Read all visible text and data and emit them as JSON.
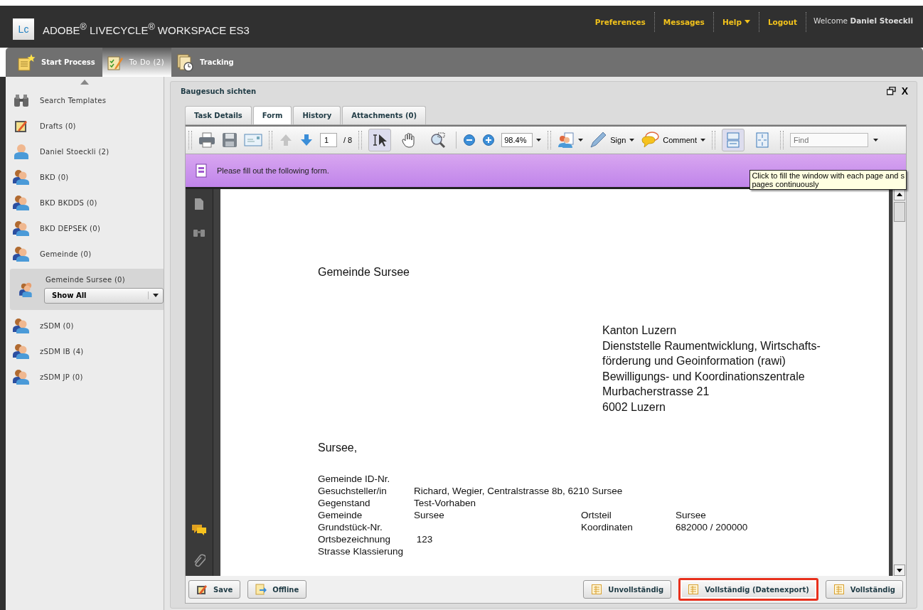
{
  "header": {
    "logo": "Lc",
    "title": "ADOBE$^{®}$ LIVECYCLE$^{®}$ WORKSPACE ES3",
    "links": [
      {
        "label": "Preferences",
        "dropdown": false
      },
      {
        "label": "Messages",
        "dropdown": false
      },
      {
        "label": "Help",
        "dropdown": true
      },
      {
        "label": "Logout",
        "dropdown": false
      }
    ],
    "welcome": "Welcome **Daniel Stoeckli**"
  },
  "app_tabs": [
    {
      "label": "Start Process",
      "kind": "start",
      "selected": false
    },
    {
      "label": "To Do (2)",
      "kind": "todo",
      "selected": true
    },
    {
      "label": "Tracking",
      "kind": "tracking",
      "selected": false
    }
  ],
  "sidebar": {
    "items": [
      {
        "label": "Search Templates",
        "kind": "search",
        "selected": false
      },
      {
        "label": "Drafts (0)",
        "kind": "drafts",
        "selected": false
      },
      {
        "label": "Daniel Stoeckli (2)",
        "kind": "person",
        "selected": false
      },
      {
        "label": "BKD (0)",
        "kind": "group",
        "selected": false
      },
      {
        "label": "BKD BKDDS (0)",
        "kind": "group",
        "selected": false
      },
      {
        "label": "BKD DEPSEK (0)",
        "kind": "group",
        "selected": false
      },
      {
        "label": "Gemeinde (0)",
        "kind": "group",
        "selected": false
      },
      {
        "label": "Gemeinde Sursee (0)",
        "kind": "group",
        "selected": true,
        "filter": "Show All"
      },
      {
        "label": "zSDM (0)",
        "kind": "group",
        "selected": false
      },
      {
        "label": "zSDM IB (4)",
        "kind": "group",
        "selected": false
      },
      {
        "label": "zSDM JP (0)",
        "kind": "group",
        "selected": false
      }
    ]
  },
  "task": {
    "title": "Baugesuch sichten",
    "close": "X",
    "tabs": [
      {
        "label": "Task Details",
        "selected": false
      },
      {
        "label": "Form",
        "selected": true
      },
      {
        "label": "History",
        "selected": false
      },
      {
        "label": "Attachments (0)",
        "selected": false
      }
    ],
    "toolbar": {
      "items": [
        {
          "kind": "grip"
        },
        {
          "kind": "print"
        },
        {
          "kind": "save"
        },
        {
          "kind": "email"
        },
        {
          "kind": "grip"
        },
        {
          "kind": "up",
          "disabled": true
        },
        {
          "kind": "down",
          "disabled": false
        },
        {
          "kind": "page",
          "value": "1",
          "total": "/ 8"
        },
        {
          "kind": "grip"
        },
        {
          "kind": "select",
          "pressed": true
        },
        {
          "kind": "hand",
          "pressed": false
        },
        {
          "kind": "marquee",
          "pressed": false
        },
        {
          "kind": "sep"
        },
        {
          "kind": "zoom-out"
        },
        {
          "kind": "zoom-in"
        },
        {
          "kind": "zoom",
          "value": "98.4%"
        },
        {
          "kind": "grip"
        },
        {
          "kind": "share"
        },
        {
          "kind": "sign",
          "label": "Sign"
        },
        {
          "kind": "comment",
          "label": "Comment"
        },
        {
          "kind": "grip"
        },
        {
          "kind": "fit-width",
          "pressed": true
        },
        {
          "kind": "fit-page",
          "pressed": false
        },
        {
          "kind": "grip"
        },
        {
          "kind": "find",
          "placeholder": "Find"
        }
      ]
    },
    "message": "Please fill out the following form.",
    "tooltip": [
      "Click to fill the window with each page and s",
      "pages continuously"
    ],
    "document": {
      "heading": "Gemeinde Sursee",
      "address": [
        "Kanton Luzern",
        "Dienststelle Raumentwicklung, Wirtschafts-",
        "förderung und Geoinformation (rawi)",
        "Bewilligungs- und Koordinationszentrale",
        "Murbacherstrasse 21",
        "6002 Luzern"
      ],
      "greeting": "Sursee,",
      "fields": [
        {
          "label": "Gemeinde ID-Nr."
        },
        {
          "label": "Gesuchsteller/in",
          "value": "Richard, Wegier, Centralstrasse 8b, 6210 Sursee"
        },
        {
          "label": "Gegenstand",
          "value": "Test-Vorhaben"
        },
        {
          "label": "Gemeinde",
          "value": "Sursee",
          "label2": "Ortsteil",
          "value2": "Sursee"
        },
        {
          "label": "Grundstück-Nr.",
          "label2": "Koordinaten",
          "value2": "682000 / 200000"
        },
        {
          "label": "Ortsbezeichnung",
          "value": " 123"
        },
        {
          "label": "Strasse Klassierung"
        }
      ]
    },
    "buttons_left": [
      {
        "label": "Save",
        "kind": "save"
      },
      {
        "label": "Offline",
        "kind": "offline"
      }
    ],
    "buttons_right": [
      {
        "label": "Unvollständig",
        "highlighted": false
      },
      {
        "label": "Vollständig (Datenexport)",
        "highlighted": true
      },
      {
        "label": "Vollständig",
        "highlighted": false
      }
    ]
  }
}
